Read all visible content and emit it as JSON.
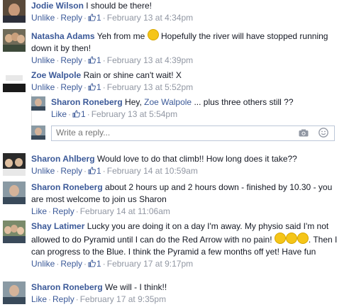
{
  "comments": [
    {
      "author": "Jodie Wilson",
      "text": "I should be there!",
      "actions": [
        "Unlike",
        "Reply"
      ],
      "likes": "1",
      "timestamp": "February 13 at 4:34pm"
    },
    {
      "author": "Natasha Adams",
      "text_before": "Yeh from me",
      "text_after": "Hopefully the river will have stopped running down it by then!",
      "actions": [
        "Unlike",
        "Reply"
      ],
      "likes": "1",
      "timestamp": "February 13 at 4:39pm"
    },
    {
      "author": "Zoe Walpole",
      "text": "Rain or shine can't wait! X",
      "actions": [
        "Unlike",
        "Reply"
      ],
      "likes": "1",
      "timestamp": "February 13 at 5:52pm"
    },
    {
      "author": "Sharon Roneberg",
      "text_before": "Hey,",
      "mention": "Zoe Walpole",
      "text_after": "... plus three others still ??",
      "actions": [
        "Like"
      ],
      "likes": "1",
      "timestamp": "February 13 at 5:54pm"
    },
    {
      "author": "Sharon Ahlberg",
      "text": "Would love to do that climb!! How long does it take??",
      "actions": [
        "Unlike",
        "Reply"
      ],
      "likes": "1",
      "timestamp": "February 14 at 10:59am"
    },
    {
      "author": "Sharon Roneberg",
      "text": "about 2 hours up and 2 hours down - finished by 10.30 - you are most welcome to join us Sharon",
      "actions": [
        "Like",
        "Reply"
      ],
      "timestamp": "February 14 at 11:06am"
    },
    {
      "author": "Shay Latimer",
      "text_before": "Lucky you are doing it on a day I'm away. My physio said I'm not allowed to do Pyramid until I can do the Red Arrow with no pain!",
      "text_after": "Then I can progress to the Blue. I think the Pyramid a few months off yet! Have fun",
      "actions": [
        "Unlike",
        "Reply"
      ],
      "likes": "1",
      "timestamp": "February 17 at 9:17pm"
    },
    {
      "author": "Sharon Roneberg",
      "text": "We will - I think!!",
      "actions": [
        "Like",
        "Reply"
      ],
      "timestamp": "February 17 at 9:35pm"
    }
  ],
  "reply_box": {
    "placeholder": "Write a reply..."
  },
  "icons": {
    "like": "thumbs-up-icon",
    "smile": "smile-emoji-icon",
    "cry": "crying-emoji-icon",
    "camera": "camera-icon",
    "emoticon": "emoticon-icon"
  },
  "colors": {
    "link": "#3b5998",
    "meta": "#9197a3",
    "text": "#141823"
  }
}
